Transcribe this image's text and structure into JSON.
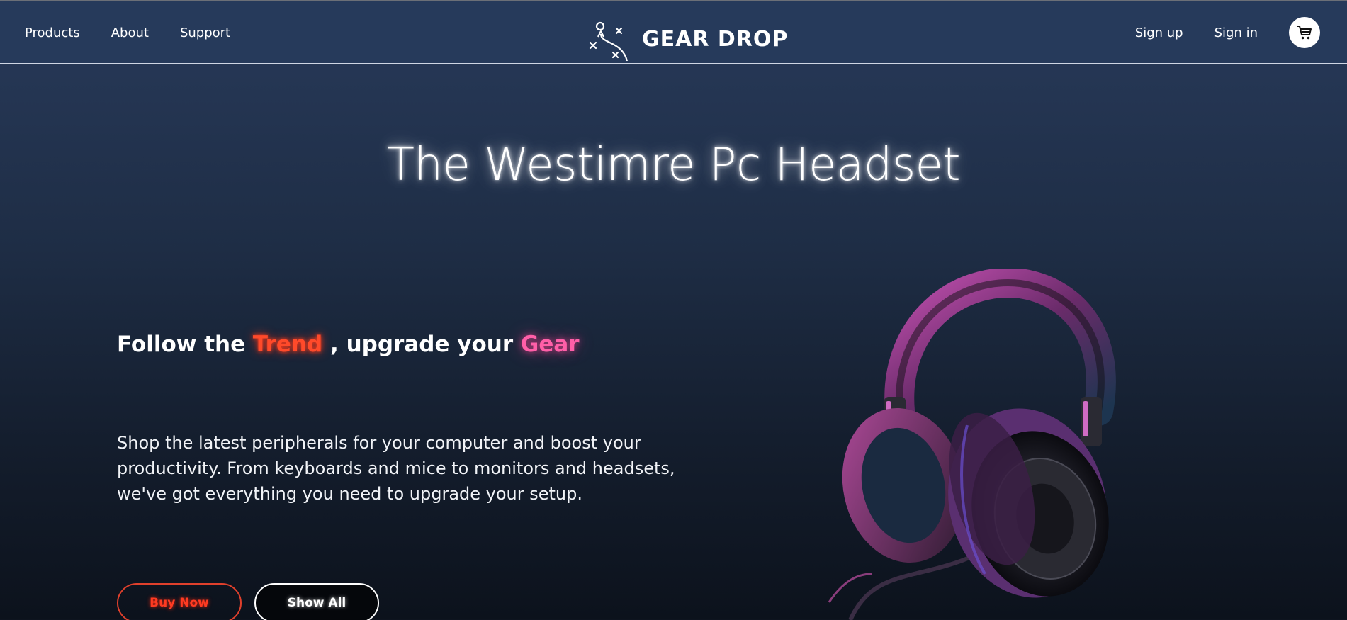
{
  "nav": {
    "left": [
      "Products",
      "About",
      "Support"
    ],
    "right": [
      "Sign up",
      "Sign in"
    ]
  },
  "brand": {
    "name": "GEAR DROP"
  },
  "icons": {
    "logo": "play-diagram-icon",
    "cart": "shopping-cart-icon"
  },
  "hero": {
    "title": "The Westimre Pc Headset",
    "tagline": {
      "pre": "Follow the ",
      "word1": "Trend",
      "mid": " , upgrade your ",
      "word2": "Gear"
    },
    "description": "Shop the latest peripherals for your computer and boost your productivity. From keyboards and mice to monitors and headsets, we've got everything you need to upgrade your setup.",
    "buttons": {
      "buy": "Buy Now",
      "show_all": "Show All"
    }
  },
  "colors": {
    "accent_red": "#ff3b22",
    "accent_pink": "#ff5fa8",
    "header_bg": "#263a5b"
  }
}
